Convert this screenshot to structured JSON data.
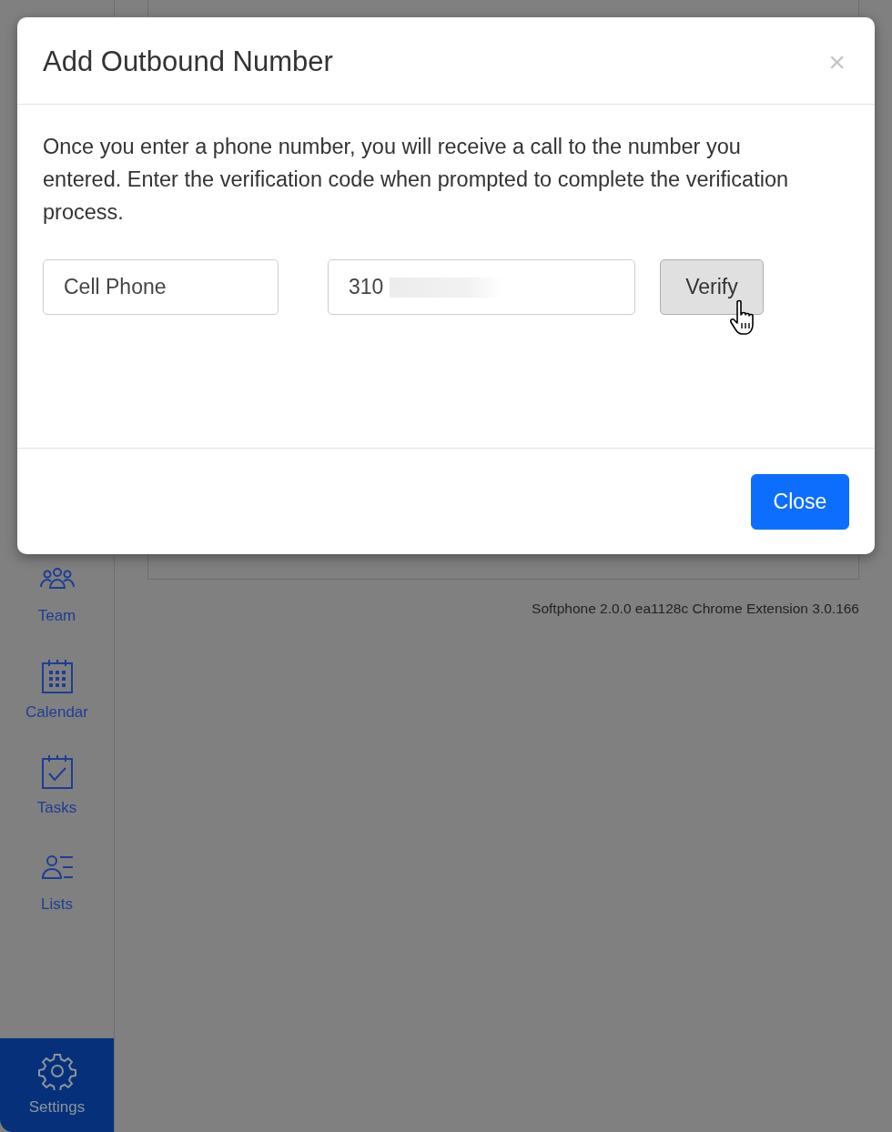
{
  "sidebar": {
    "items": [
      {
        "label": "Team",
        "selected": false
      },
      {
        "label": "Calendar",
        "selected": false
      },
      {
        "label": "Tasks",
        "selected": false
      },
      {
        "label": "Lists",
        "selected": false
      },
      {
        "label": "Settings",
        "selected": true
      }
    ]
  },
  "version_text": "Softphone 2.0.0 ea1128c Chrome Extension 3.0.166",
  "modal": {
    "title": "Add Outbound Number",
    "close_symbol": "×",
    "message": "Once you enter a phone number, you will receive a call to the number you entered. Enter the verification code when prompted to complete the verification process.",
    "type_field": {
      "value": "Cell Phone"
    },
    "phone_field": {
      "value": "310"
    },
    "verify_button": "Verify",
    "close_button": "Close"
  }
}
